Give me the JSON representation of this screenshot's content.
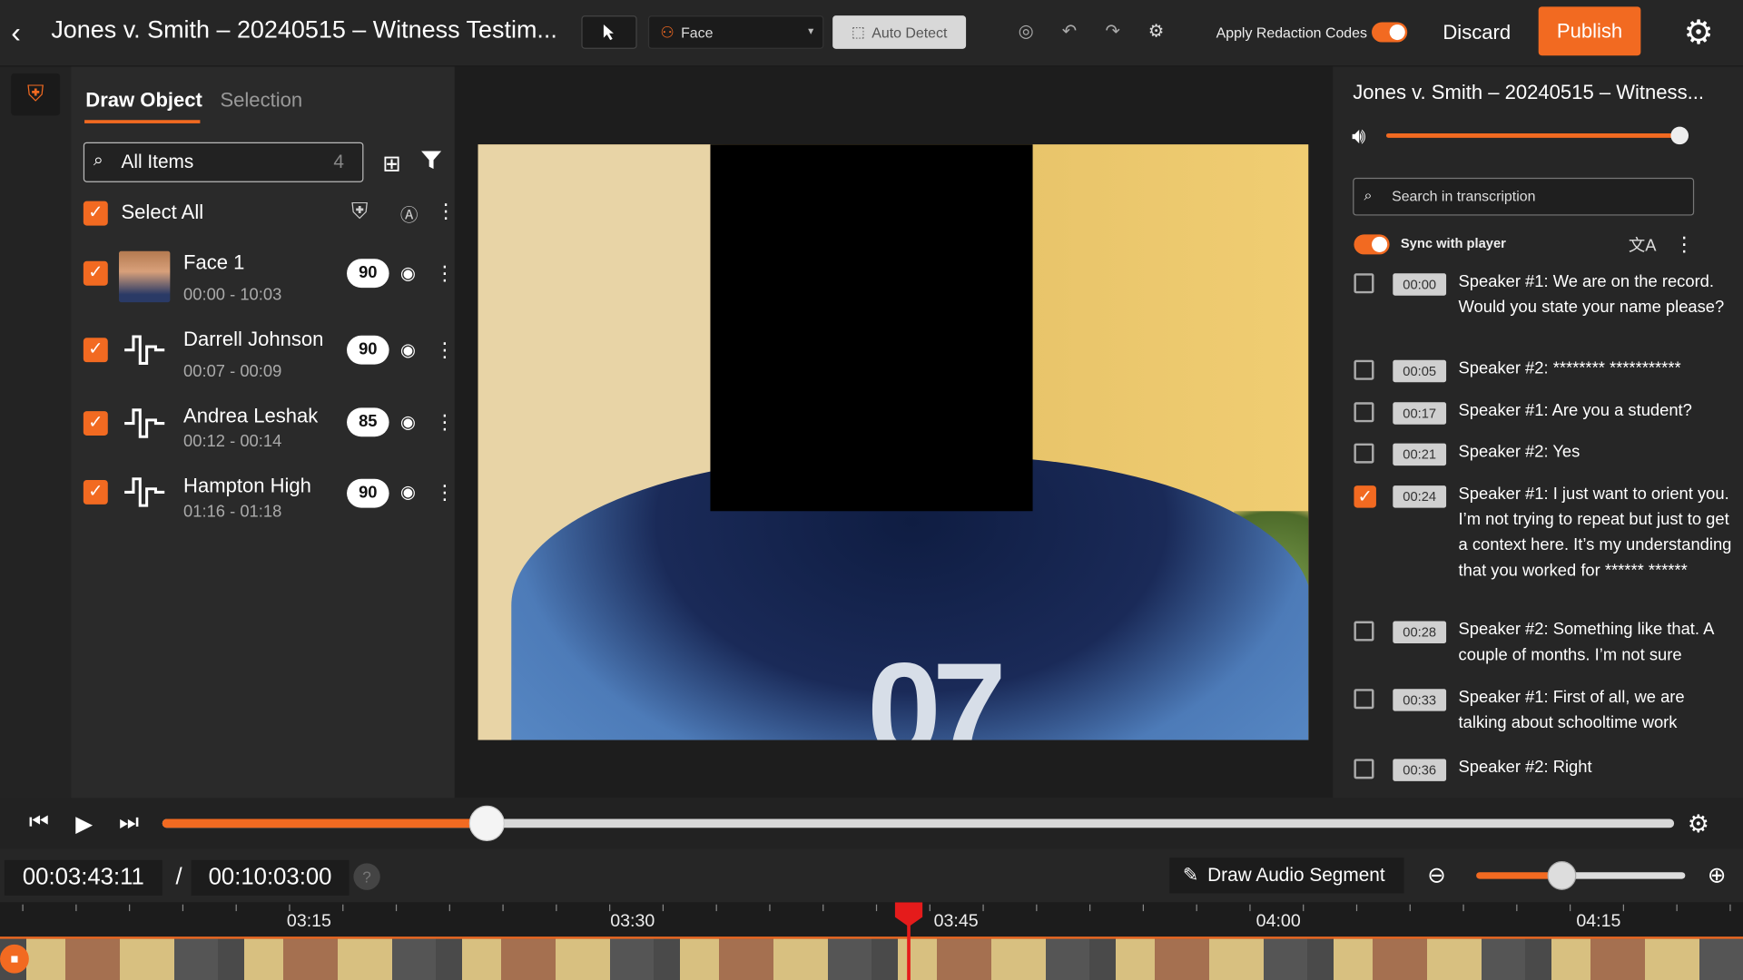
{
  "topbar": {
    "title": "Jones v. Smith – 20240515 – Witness Testim...",
    "face_dropdown": "Face",
    "auto_detect": "Auto Detect",
    "apply_redaction_codes": "Apply Redaction Codes",
    "discard": "Discard",
    "publish": "Publish"
  },
  "left_panel": {
    "tabs": [
      "Draw Object",
      "Selection"
    ],
    "search_placeholder": "All Items",
    "search_count": "4",
    "select_all": "Select All",
    "items": [
      {
        "title": "Face 1",
        "time": "00:00 - 10:03",
        "score": "90",
        "kind": "face"
      },
      {
        "title": "Darrell Johnson",
        "time": "00:07 - 00:09",
        "score": "90",
        "kind": "audio"
      },
      {
        "title": "Andrea Leshak",
        "time": "00:12 - 00:14",
        "score": "85",
        "kind": "audio"
      },
      {
        "title": "Hampton High",
        "time": "01:16 - 01:18",
        "score": "90",
        "kind": "audio"
      }
    ]
  },
  "right_panel": {
    "title": "Jones v. Smith – 20240515 – Witness...",
    "volume": 1.0,
    "search_placeholder": "Search in transcription",
    "sync_label": "Sync with player",
    "transcript": [
      {
        "time": "00:00",
        "text": "Speaker #1: We are on the record. Would you state your name please?",
        "checked": false
      },
      {
        "time": "00:05",
        "text": "Speaker #2: ******** ***********",
        "checked": false
      },
      {
        "time": "00:17",
        "text": "Speaker #1: Are you a student?",
        "checked": false
      },
      {
        "time": "00:21",
        "text": "Speaker #2: Yes",
        "checked": false
      },
      {
        "time": "00:24",
        "text": "Speaker #1: I just want to orient you. I’m not trying to repeat but just to get a context here. It’s my understanding that you worked for ****** ******",
        "checked": true
      },
      {
        "time": "00:28",
        "text": "Speaker #2: Something like that. A couple of months. I’m not sure",
        "checked": false
      },
      {
        "time": "00:33",
        "text": "Speaker #1: First of all, we are talking about schooltime work",
        "checked": false
      },
      {
        "time": "00:36",
        "text": "Speaker #2: Right",
        "checked": false
      }
    ]
  },
  "video": {
    "jersey_number": "07"
  },
  "player": {
    "current_time": "00:03:43:11",
    "separator": "/",
    "total_time": "00:10:03:00",
    "help": "?",
    "progress": 0.215,
    "draw_audio_segment": "Draw Audio Segment",
    "zoom_level": 0.42
  },
  "timeline": {
    "labels": [
      "03:15",
      "03:30",
      "03:45",
      "04:00",
      "04:15"
    ]
  },
  "colors": {
    "accent": "#f26a21",
    "playhead": "#e51b1b"
  }
}
